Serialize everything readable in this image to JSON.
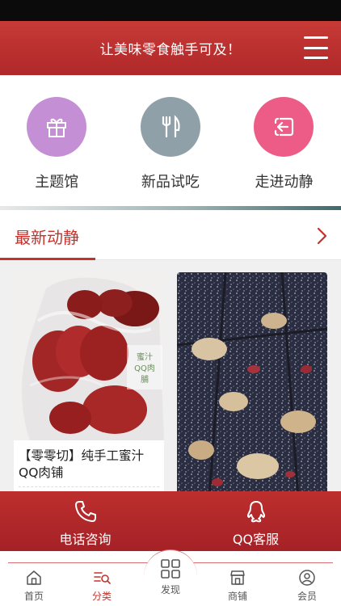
{
  "header": {
    "title": "让美味零食触手可及！",
    "menu_icon": "menu-icon"
  },
  "quick_nav": [
    {
      "label": "主题馆",
      "icon": "gift-icon",
      "color": "#c58fd6"
    },
    {
      "label": "新品试吃",
      "icon": "fork-knife-icon",
      "color": "#8fa0a9"
    },
    {
      "label": "走进动静",
      "icon": "enter-icon",
      "color": "#ec5c86"
    }
  ],
  "news": {
    "title": "最新动静",
    "arrow_icon": "chevron-right-icon"
  },
  "cards": [
    {
      "title": "【零零切】纯手工蜜汁QQ肉铺",
      "image_label": "蜜汁QQ肉脯"
    },
    {
      "title": ""
    }
  ],
  "contact": [
    {
      "label": "电话咨询",
      "icon": "phone-icon"
    },
    {
      "label": "QQ客服",
      "icon": "qq-icon"
    }
  ],
  "tabs": [
    {
      "label": "首页",
      "icon": "home-icon",
      "active": false
    },
    {
      "label": "分类",
      "icon": "category-icon",
      "active": true
    },
    {
      "label": "发现",
      "icon": "discover-icon",
      "active": false
    },
    {
      "label": "商铺",
      "icon": "shop-icon",
      "active": false
    },
    {
      "label": "会员",
      "icon": "member-icon",
      "active": false
    }
  ],
  "colors": {
    "brand_red": "#c8302b",
    "header_red": "#b0282a"
  }
}
